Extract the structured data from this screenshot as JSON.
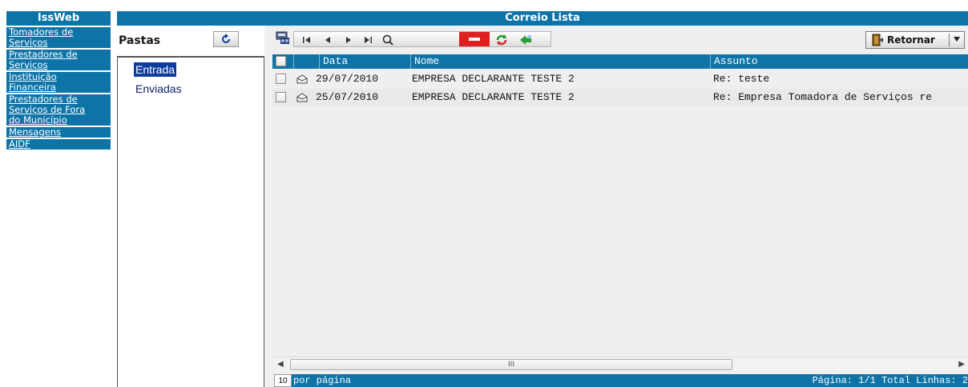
{
  "sidebar": {
    "title": "IssWeb",
    "items": [
      {
        "label": "Tomadores de\nServiços"
      },
      {
        "label": "Prestadores de\nServiços"
      },
      {
        "label": "Instituição\nFinanceira"
      },
      {
        "label": "Prestadores de\nServiços de Fora\ndo Município"
      },
      {
        "label": "Mensagens"
      },
      {
        "label": "AIDF"
      }
    ]
  },
  "header": {
    "title": "Correio Lista"
  },
  "folders": {
    "title": "Pastas",
    "refresh_icon": "refresh-icon",
    "items": [
      {
        "label": "Entrada"
      },
      {
        "label": "Enviadas"
      }
    ]
  },
  "toolbar": {
    "retornar_label": "Retornar",
    "icons": [
      "new-mail-icon",
      "first-page-icon",
      "prev-page-icon",
      "next-page-icon",
      "last-page-icon",
      "search-icon",
      "delete-icon",
      "reload-icon",
      "forward-icon"
    ]
  },
  "grid": {
    "columns": {
      "data": "Data",
      "nome": "Nome",
      "assunto": "Assunto"
    },
    "rows": [
      {
        "data": "29/07/2010",
        "nome": "EMPRESA DECLARANTE TESTE 2",
        "assunto": "Re: teste"
      },
      {
        "data": "25/07/2010",
        "nome": "EMPRESA DECLARANTE TESTE 2",
        "assunto": "Re: Empresa Tomadora de Serviços re"
      }
    ]
  },
  "scrollbar": {
    "grip": "III"
  },
  "footer": {
    "per_page_value": "10",
    "per_page_label": "por página",
    "page_info": "Página: 1/1 Total Linhas: 2"
  },
  "colors": {
    "accent": "#0e74a8",
    "selected_folder": "#0b3c9e",
    "panel_bg": "#efefef"
  }
}
